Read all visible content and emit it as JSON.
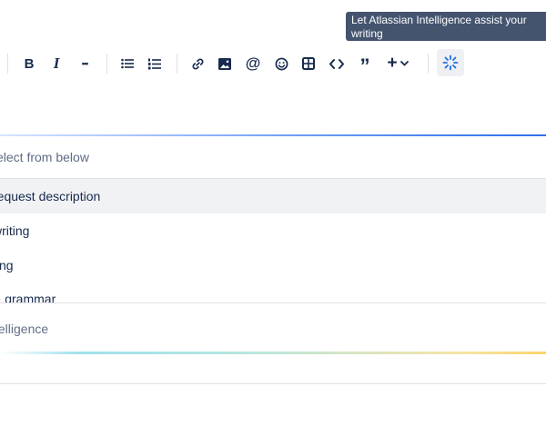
{
  "tooltip": {
    "text": "Let Atlassian Intelligence assist your writing"
  },
  "toolbar": {
    "buttons": [
      {
        "name": "bold",
        "icon": "bold-icon",
        "glyph": "B"
      },
      {
        "name": "italic",
        "icon": "italic-icon",
        "glyph": "I"
      },
      {
        "name": "more-formatting",
        "icon": "more-icon",
        "glyph": "•••"
      },
      {
        "name": "bullet-list",
        "icon": "bullet-list-icon"
      },
      {
        "name": "numbered-list",
        "icon": "numbered-list-icon"
      },
      {
        "name": "link",
        "icon": "link-icon"
      },
      {
        "name": "image",
        "icon": "image-icon"
      },
      {
        "name": "mention",
        "icon": "at-sign-icon",
        "glyph": "@"
      },
      {
        "name": "emoji",
        "icon": "emoji-icon"
      },
      {
        "name": "table",
        "icon": "table-icon"
      },
      {
        "name": "code",
        "icon": "code-icon",
        "glyph": "<>"
      },
      {
        "name": "quote",
        "icon": "quote-icon",
        "glyph": "99"
      },
      {
        "name": "insert-more",
        "icon": "plus-chevron-icon",
        "glyph": "+"
      },
      {
        "name": "atlassian-intelligence",
        "icon": "ai-sparkle-icon"
      }
    ]
  },
  "panel": {
    "search_placeholder": "elect from below",
    "items": [
      {
        "label": "request description",
        "selected": true
      },
      {
        "label": "writing",
        "selected": false
      },
      {
        "label": "ting",
        "selected": false
      },
      {
        "label": "& grammar",
        "selected": false
      }
    ],
    "ai_input_placeholder": "telligence"
  },
  "colors": {
    "accent": "#2f6fe8",
    "tooltip_bg": "#44546f",
    "selected_row": "#f1f2f4"
  }
}
